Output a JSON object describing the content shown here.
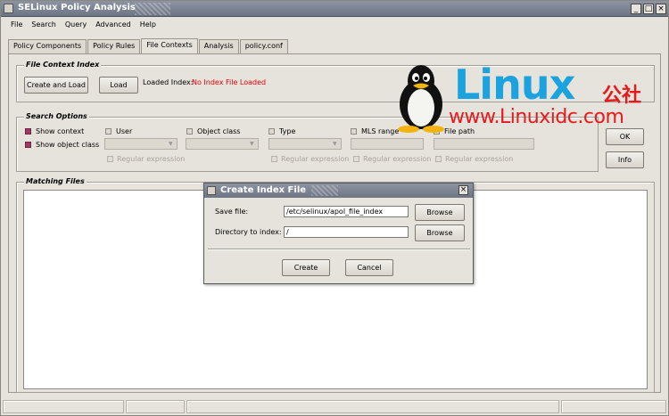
{
  "window": {
    "title": "SELinux Policy Analysis",
    "controls": {
      "minimize": "_",
      "maximize": "□",
      "close": "×"
    }
  },
  "menubar": {
    "items": [
      "File",
      "Search",
      "Query",
      "Advanced",
      "Help"
    ]
  },
  "tabs": [
    {
      "label": "Policy Components",
      "active": false
    },
    {
      "label": "Policy Rules",
      "active": false
    },
    {
      "label": "File Contexts",
      "active": true
    },
    {
      "label": "Analysis",
      "active": false
    },
    {
      "label": "policy.conf",
      "active": false
    }
  ],
  "file_context_index": {
    "group_title": "File Context Index",
    "create_and_load_label": "Create and Load",
    "load_label": "Load",
    "loaded_index_label": "Loaded Index:",
    "loaded_index_value": "No Index File Loaded"
  },
  "search_options": {
    "group_title": "Search Options",
    "show_context": "Show context",
    "show_object_class": "Show object class",
    "user": "User",
    "object_class": "Object class",
    "type": "Type",
    "mls_range": "MLS range",
    "file_path": "File path",
    "regex_label": "Regular expression",
    "ok_label": "OK",
    "info_label": "Info"
  },
  "matching_files": {
    "group_title": "Matching Files"
  },
  "watermark": {
    "brand_word": "Linux",
    "brand_suffix": "公社",
    "url": "www.Linuxidc.com"
  },
  "dialog": {
    "title": "Create Index File",
    "close_glyph": "×",
    "save_file_label": "Save file:",
    "save_file_value": "/etc/selinux/apol_file_index",
    "directory_label": "Directory to index:",
    "directory_value": "/",
    "browse_label": "Browse",
    "create_label": "Create",
    "cancel_label": "Cancel"
  },
  "colors": {
    "titlebar": "#7d8494",
    "background": "#e6e3dc",
    "checkbox_on": "#9c3b62",
    "alert_text": "#e00000",
    "watermark_blue": "#1aa3df",
    "watermark_red": "#e61a1a"
  }
}
